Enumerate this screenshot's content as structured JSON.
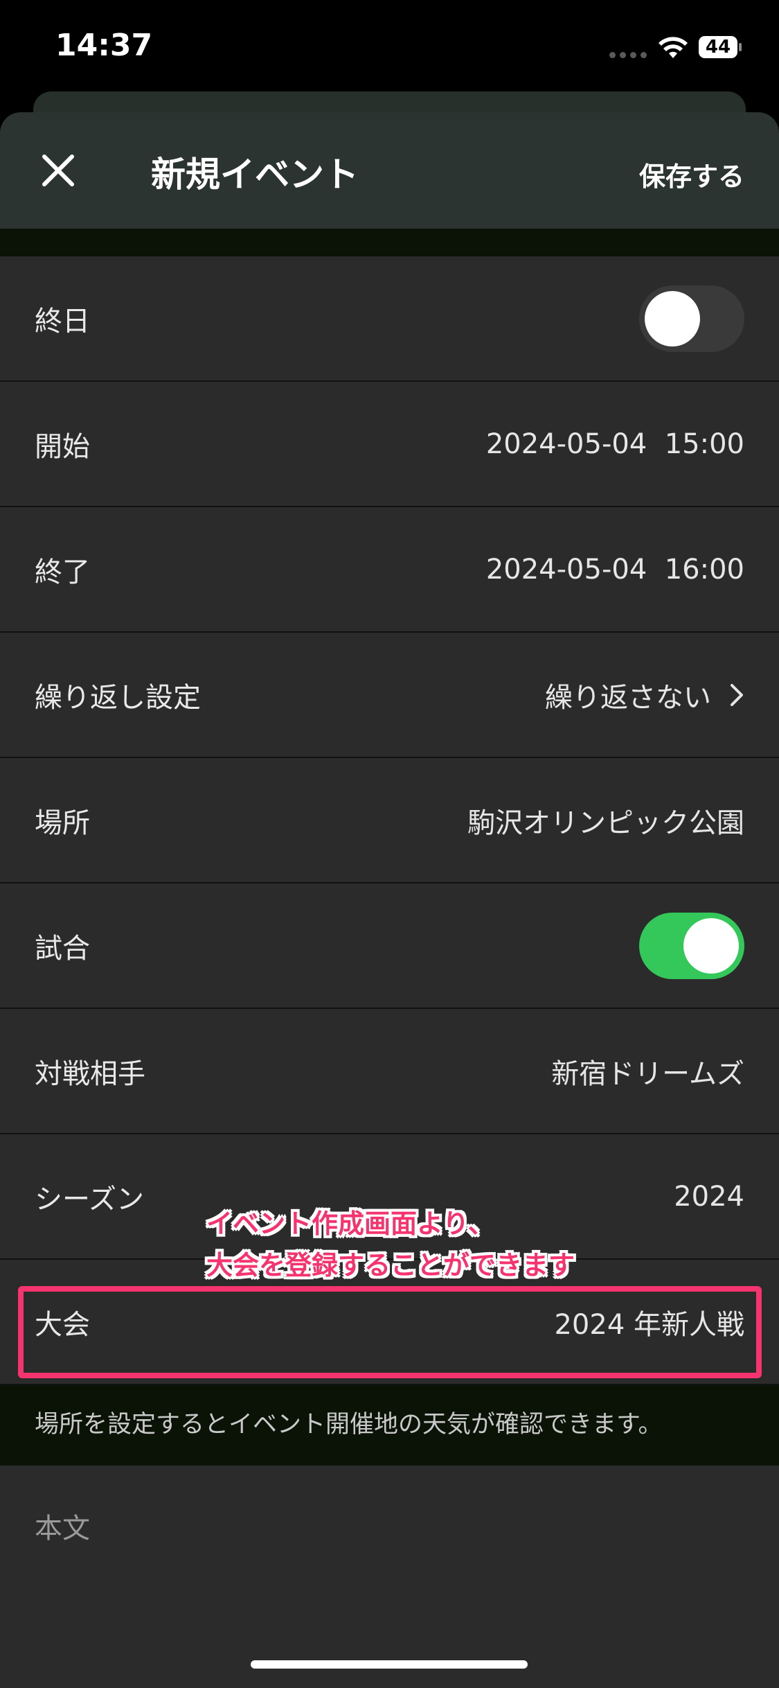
{
  "status_bar": {
    "time": "14:37",
    "battery": "44"
  },
  "nav": {
    "title": "新規イベント",
    "save_label": "保存する"
  },
  "rows": {
    "all_day": {
      "label": "終日"
    },
    "start": {
      "label": "開始",
      "value": "2024-05-04  15:00"
    },
    "end": {
      "label": "終了",
      "value": "2024-05-04  16:00"
    },
    "repeat": {
      "label": "繰り返し設定",
      "value": "繰り返さない"
    },
    "place": {
      "label": "場所",
      "value": "駒沢オリンピック公園"
    },
    "match": {
      "label": "試合"
    },
    "opponent": {
      "label": "対戦相手",
      "value": "新宿ドリームズ"
    },
    "season": {
      "label": "シーズン",
      "value": "2024"
    },
    "tournament": {
      "label": "大会",
      "value": "2024 年新人戦"
    }
  },
  "hint": "場所を設定するとイベント開催地の天気が確認できます。",
  "body_label": "本文",
  "annotation": {
    "line1": "イベント作成画面より、",
    "line2": "大会を登録することができます"
  },
  "colors": {
    "accent_green": "#34c759",
    "annotation_pink": "#f5336e",
    "nav_bg": "#2b3430",
    "row_bg": "#2b2b2b"
  },
  "toggles": {
    "all_day_on": false,
    "match_on": true
  }
}
